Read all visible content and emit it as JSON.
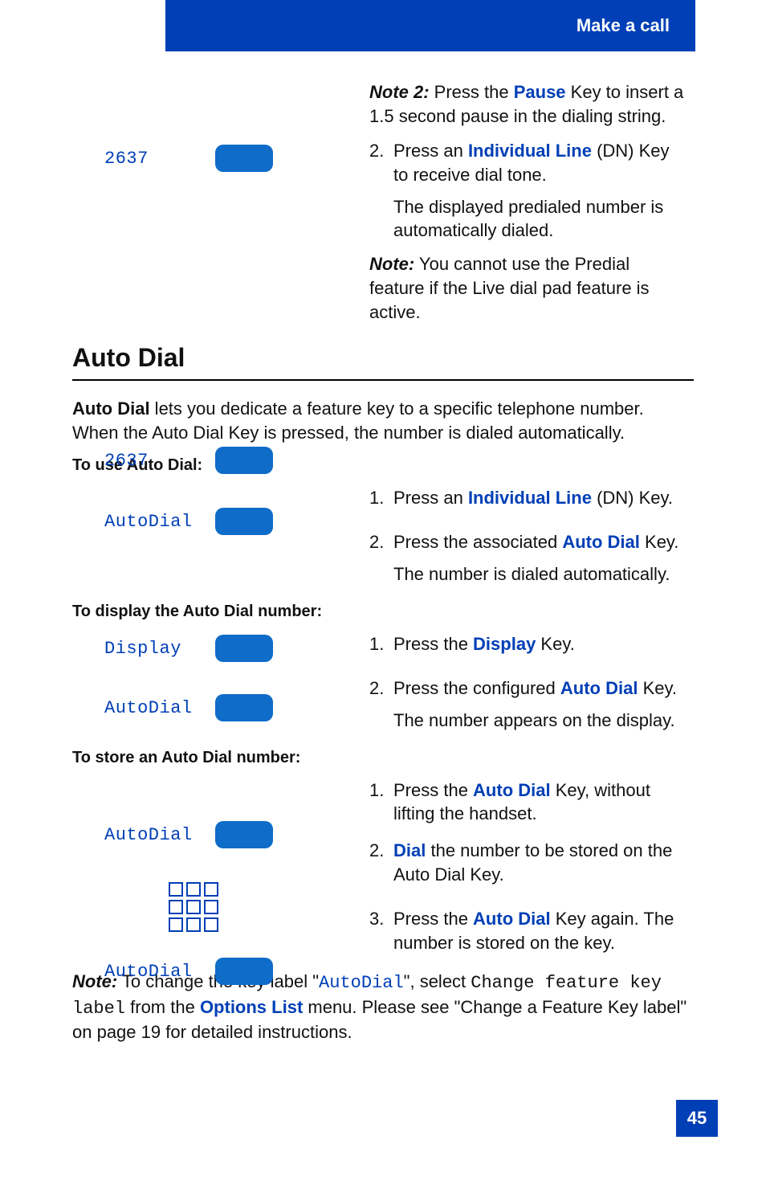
{
  "header": {
    "title": "Make a call"
  },
  "note2": {
    "label": "Note 2:",
    "before": "   Press the ",
    "key": "Pause",
    "after": " Key to insert a 1.5 second pause in the dialing string."
  },
  "predial": {
    "key_label": "2637",
    "step2_num": "2.",
    "step2a_before": "Press an ",
    "step2a_key": "Individual Line",
    "step2a_after": " (DN) Key to receive dial tone.",
    "step2b": "The displayed predialed number is automatically dialed.",
    "noteLabel": "Note:",
    "noteText": " You cannot use the Predial feature if the Live dial pad feature is active."
  },
  "auto_dial": {
    "heading": "Auto Dial",
    "intro_bold": "Auto Dial",
    "intro_rest": " lets you dedicate a feature key to a specific telephone number. When the Auto Dial Key is pressed, the number is dialed automatically.",
    "use_sub": "To use Auto Dial:",
    "use": {
      "row1_label": "2637",
      "s1_num": "1.",
      "s1_before": "Press an ",
      "s1_key": "Individual Line",
      "s1_after": " (DN) Key.",
      "row2_label": "AutoDial",
      "s2_num": "2.",
      "s2_before": "Press the associated ",
      "s2_key": "Auto Dial",
      "s2_after": " Key.",
      "s2_sub": "The number is dialed automatically."
    },
    "display_sub": "To display the Auto Dial number:",
    "display": {
      "row1_label": "Display",
      "s1_num": "1.",
      "s1_before": "Press the ",
      "s1_key": "Display",
      "s1_after": " Key.",
      "row2_label": "AutoDial",
      "s2_num": "2.",
      "s2_before": "Press the configured ",
      "s2_key": "Auto Dial",
      "s2_after": " Key.",
      "s2_sub": " The number appears on the display."
    },
    "store_sub": "To store an Auto Dial number:",
    "store": {
      "row1_label": "AutoDial",
      "s1_num": "1.",
      "s1_before": "Press the ",
      "s1_key": "Auto Dial",
      "s1_after": " Key, without lifting the handset.",
      "s2_num": "2.",
      "s2_key": "Dial",
      "s2_after": " the number to be stored on the Auto Dial Key.",
      "row3_label": "AutoDial",
      "s3_num": "3.",
      "s3_before": "Press the ",
      "s3_key": "Auto Dial",
      "s3_after": " Key again. The number is stored on the key."
    },
    "footnote": {
      "label": "Note:",
      "p1": " To change the key label \"",
      "mono1": "AutoDial",
      "p2": "\", select ",
      "mono2": "Change feature key label",
      "p3": " from the ",
      "key": "Options List",
      "p4": " menu. Please see \"Change a Feature Key label\" on page 19 for detailed instructions."
    }
  },
  "page_number": "45"
}
